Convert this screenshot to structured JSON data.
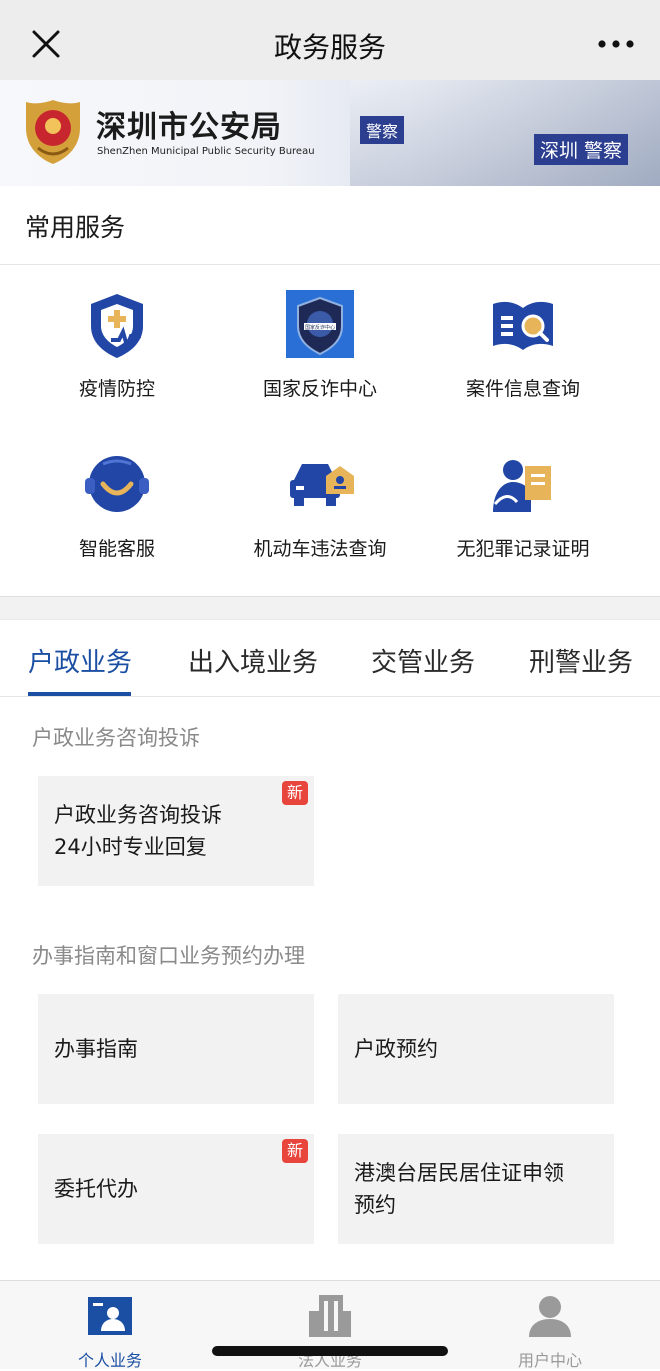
{
  "nav": {
    "title": "政务服务",
    "close_icon": "close-icon",
    "more_icon": "more-icon"
  },
  "banner": {
    "org_name": "深圳市公安局",
    "org_name_en": "ShenZhen Municipal Public Security Bureau",
    "frag_left": "警察",
    "frag_right": "深圳 警察"
  },
  "common_services": {
    "title": "常用服务",
    "items": [
      {
        "label": "疫情防控",
        "icon": "shield-medical-icon"
      },
      {
        "label": "国家反诈中心",
        "icon": "anti-fraud-app-icon",
        "icon_text": "国家反诈中心"
      },
      {
        "label": "案件信息查询",
        "icon": "book-search-icon"
      },
      {
        "label": "智能客服",
        "icon": "smiley-chat-icon"
      },
      {
        "label": "机动车违法查询",
        "icon": "car-icon"
      },
      {
        "label": "无犯罪记录证明",
        "icon": "person-certificate-icon"
      }
    ]
  },
  "tabs": [
    {
      "label": "户政业务",
      "active": true
    },
    {
      "label": "出入境业务",
      "active": false
    },
    {
      "label": "交管业务",
      "active": false
    },
    {
      "label": "刑警业务",
      "active": false
    }
  ],
  "sections": [
    {
      "title": "户政业务咨询投诉",
      "cards": [
        {
          "label": "户政业务咨询投诉\n24小时专业回复",
          "badge": "新"
        }
      ]
    },
    {
      "title": "办事指南和窗口业务预约办理",
      "cards": [
        {
          "label": "办事指南",
          "badge": ""
        },
        {
          "label": "户政预约",
          "badge": ""
        },
        {
          "label": "委托代办",
          "badge": "新"
        },
        {
          "label": "港澳台居民居住证申领\n预约",
          "badge": ""
        }
      ]
    }
  ],
  "bottom_nav": [
    {
      "label": "个人业务",
      "icon": "person-card-icon",
      "active": true
    },
    {
      "label": "法人业务",
      "icon": "building-icon",
      "active": false
    },
    {
      "label": "用户中心",
      "icon": "user-icon",
      "active": false
    }
  ],
  "colors": {
    "accent": "#1b4fa3",
    "badge": "#e8453c",
    "icon_blue": "#2146a6",
    "icon_gold": "#e7b45a"
  }
}
